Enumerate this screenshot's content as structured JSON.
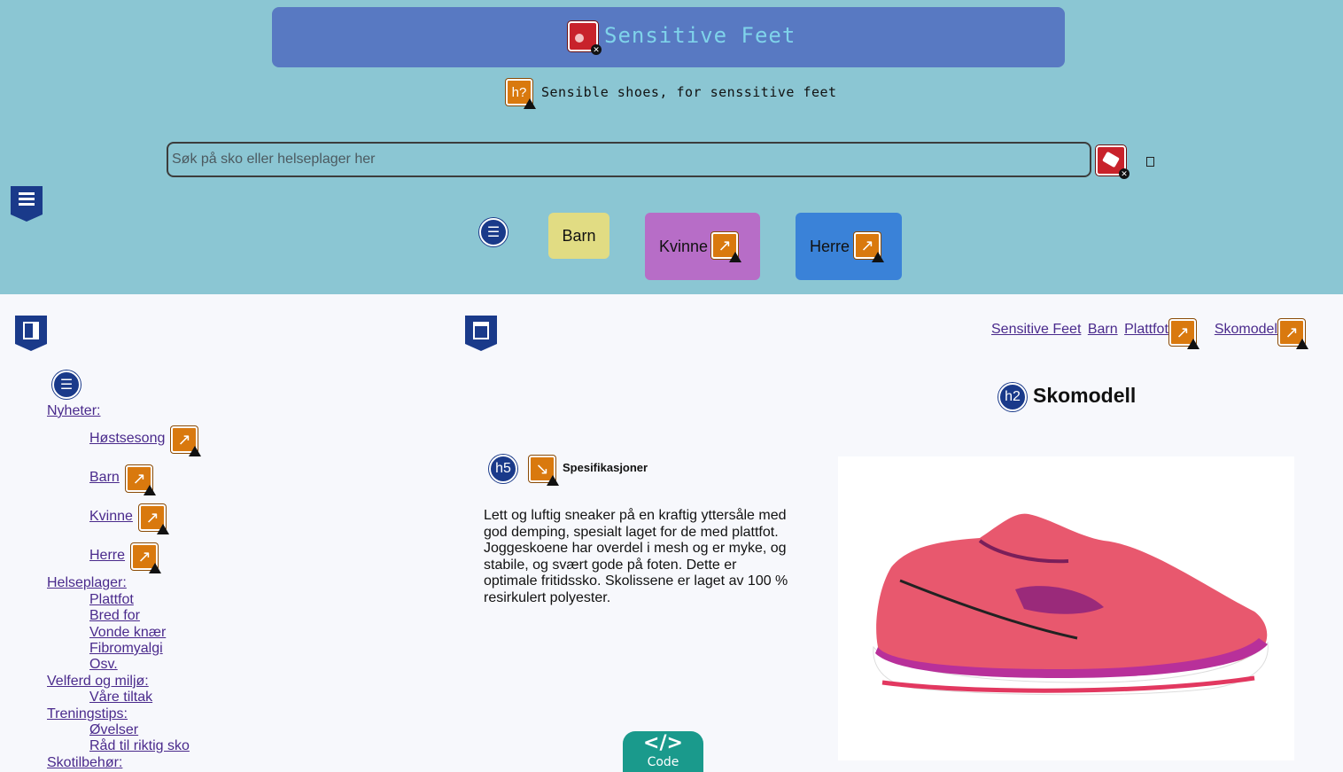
{
  "header": {
    "site_title": "Sensitive Feet",
    "tagline": "Sensible shoes, for senssitive feet",
    "search_placeholder": "Søk på sko eller helseplager her"
  },
  "nav": {
    "barn": "Barn",
    "kvinne": "Kvinne",
    "herre": "Herre"
  },
  "breadcrumb": [
    "Sensitive Feet",
    "Barn",
    "Plattfot",
    "Skomodell"
  ],
  "product": {
    "heading": "Skomodell",
    "specs_heading": "Spesifikasjoner",
    "description": "Lett og luftig sneaker på en kraftig yttersåle med god demping, spesialt laget for de med plattfot. Joggeskoene har overdel i mesh og er myke, og stabile, og svært gode på foten. Dette er optimale fritidssko. Skolissene er laget av 100 % resirkulert polyester."
  },
  "sidebar": {
    "nyheter": "Nyheter:",
    "nyheter_items": [
      "Høstsesong",
      "Barn",
      "Kvinne",
      "Herre"
    ],
    "helseplager": "Helseplager:",
    "helseplager_items": [
      "Plattfot",
      "Bred for",
      "Vonde knær",
      "Fibromyalgi",
      "Osv."
    ],
    "velferd": "Velferd og miljø:",
    "velferd_items": [
      "Våre tiltak"
    ],
    "trening": "Treningstips:",
    "trening_items": [
      "Øvelser",
      "Råd til riktig sko"
    ],
    "skotilbehor": "Skotilbehør:"
  },
  "badges": {
    "list": "☰",
    "h2": "h2",
    "h5": "h5",
    "h_question": "h?"
  },
  "code_tab": {
    "symbol": "</>",
    "label": "Code"
  },
  "colors": {
    "header_bg": "#8bc6d3",
    "title_bar": "#5879c2",
    "barn_bg": "#e1dc83",
    "kvinne_bg": "#b76dc7",
    "herre_bg": "#3a82d8",
    "link": "#4a2a8c",
    "code_tab": "#1a9a8c"
  }
}
